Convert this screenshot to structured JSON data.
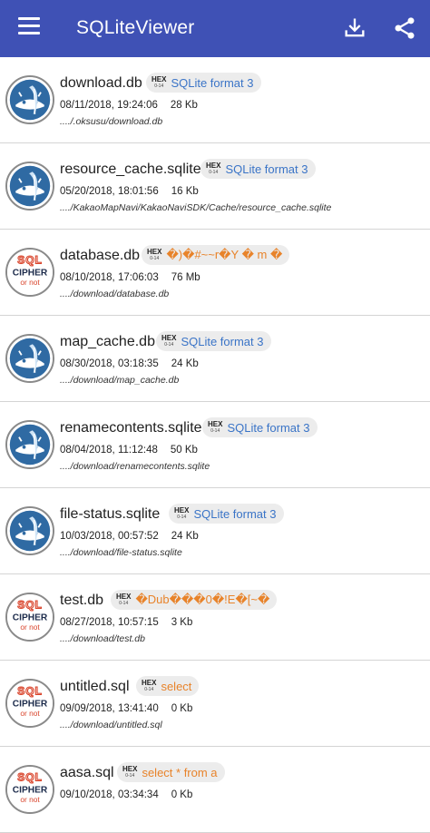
{
  "appbar": {
    "title": "SQLiteViewer",
    "color": "#3f51b5",
    "menu_icon": "menu-icon",
    "download_icon": "download-icon",
    "share_icon": "share-icon"
  },
  "badge_label": {
    "hex": "HEX",
    "range": "0-14"
  },
  "colors": {
    "signature_sqlite": "#3a74c7",
    "signature_other": "#e8832a"
  },
  "files": [
    {
      "icon": "sqlite-android-icon",
      "name": "download.db",
      "signature": "SQLite format 3",
      "date": "08/11/2018, 19:24:06",
      "size": "28 Kb",
      "path": "..../.oksusu/download.db"
    },
    {
      "icon": "sqlite-android-icon",
      "name": "resource_cache.sqlite",
      "signature": "SQLite format 3",
      "date": "05/20/2018, 18:01:56",
      "size": "16 Kb",
      "path": "..../KakaoMapNavi/KakaoNaviSDK/Cache/resource_cache.sqlite"
    },
    {
      "icon": "sqlcipher-icon",
      "name": "database.db",
      "signature": "�)�#~~r�Y � m �",
      "date": "08/10/2018, 17:06:03",
      "size": "76 Mb",
      "path": "..../download/database.db"
    },
    {
      "icon": "sqlite-android-icon",
      "name": "map_cache.db",
      "signature": "SQLite format 3",
      "date": "08/30/2018, 03:18:35",
      "size": "24 Kb",
      "path": "..../download/map_cache.db"
    },
    {
      "icon": "sqlite-android-icon",
      "name": "renamecontents.sqlite",
      "signature": "SQLite format 3",
      "date": "08/04/2018, 11:12:48",
      "size": "50 Kb",
      "path": "..../download/renamecontents.sqlite"
    },
    {
      "icon": "sqlite-android-icon",
      "name": "file-status.sqlite",
      "signature": "SQLite format 3",
      "date": "10/03/2018, 00:57:52",
      "size": "24 Kb",
      "path": "..../download/file-status.sqlite"
    },
    {
      "icon": "sqlcipher-icon",
      "name": "test.db",
      "signature": "�Dub���0�!E�[~�",
      "date": "08/27/2018, 10:57:15",
      "size": "3 Kb",
      "path": "..../download/test.db"
    },
    {
      "icon": "sqlcipher-icon",
      "name": "untitled.sql",
      "signature": "select",
      "date": "09/09/2018, 13:41:40",
      "size": "0 Kb",
      "path": "..../download/untitled.sql"
    },
    {
      "icon": "sqlcipher-icon",
      "name": "aasa.sql",
      "signature": "select * from a",
      "date": "09/10/2018, 03:34:34",
      "size": "0 Kb",
      "path": ""
    }
  ],
  "sqlcipher_logo": {
    "line1": "SQL",
    "line2": "CIPHER",
    "line3": "or not"
  }
}
